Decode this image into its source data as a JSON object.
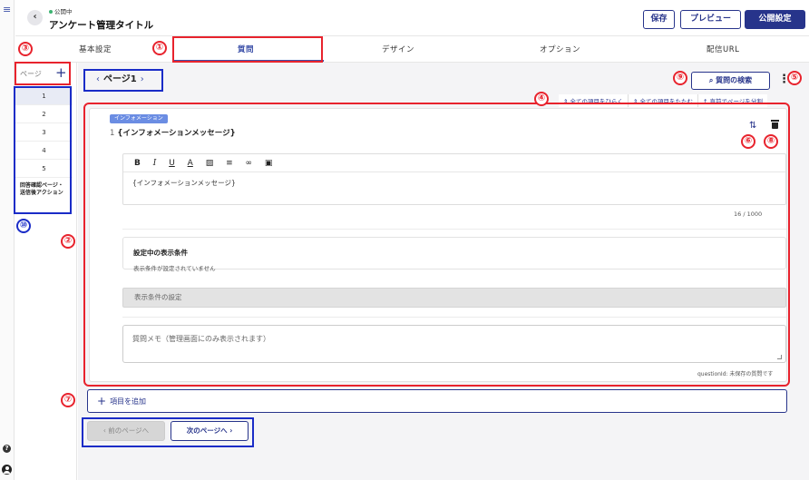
{
  "header": {
    "status": "公開中",
    "title": "アンケート管理タイトル",
    "save_label": "保存",
    "preview_label": "プレビュー",
    "publish_label": "公開設定"
  },
  "tabs": [
    {
      "label": "基本設定"
    },
    {
      "label": "質問"
    },
    {
      "label": "デザイン"
    },
    {
      "label": "オプション"
    },
    {
      "label": "配信URL"
    }
  ],
  "sidebar": {
    "label": "ページ",
    "add_icon": "plus-icon",
    "pages": [
      "1",
      "2",
      "3",
      "4",
      "5"
    ],
    "final_page": "回答確認ページ・\n送信後アクション"
  },
  "page_nav": {
    "label": "ページ1"
  },
  "toolbar": {
    "search_label": "質問の検索",
    "expand_all": "全ての項目をひらく",
    "collapse_all": "全ての項目をたたむ",
    "split_page": "直前でページを分割"
  },
  "question": {
    "badge": "インフォメーション",
    "number": "1",
    "title": "{インフォメーションメッセージ}",
    "editor_text": "{インフォメーションメッセージ}",
    "char_count": "16 / 1000",
    "condition_heading": "設定中の表示条件",
    "condition_status": "表示条件が設定されていません",
    "condition_button": "表示条件の設定",
    "memo_placeholder": "質問メモ（管理画面にのみ表示されます）",
    "question_id": "questionId: 未保存の質問です"
  },
  "add_item_label": "項目を追加",
  "pager": {
    "prev_label": "前のページへ",
    "next_label": "次のページへ"
  },
  "annotations": [
    "①",
    "②",
    "③",
    "④",
    "⑤",
    "⑥",
    "⑦",
    "⑧",
    "⑨",
    "⑩"
  ],
  "colors": {
    "primary": "#27348b",
    "accent": "#3b4fa8",
    "annotation_red": "#e8232d",
    "annotation_blue": "#1a2cc7",
    "badge": "#6b8de3"
  }
}
